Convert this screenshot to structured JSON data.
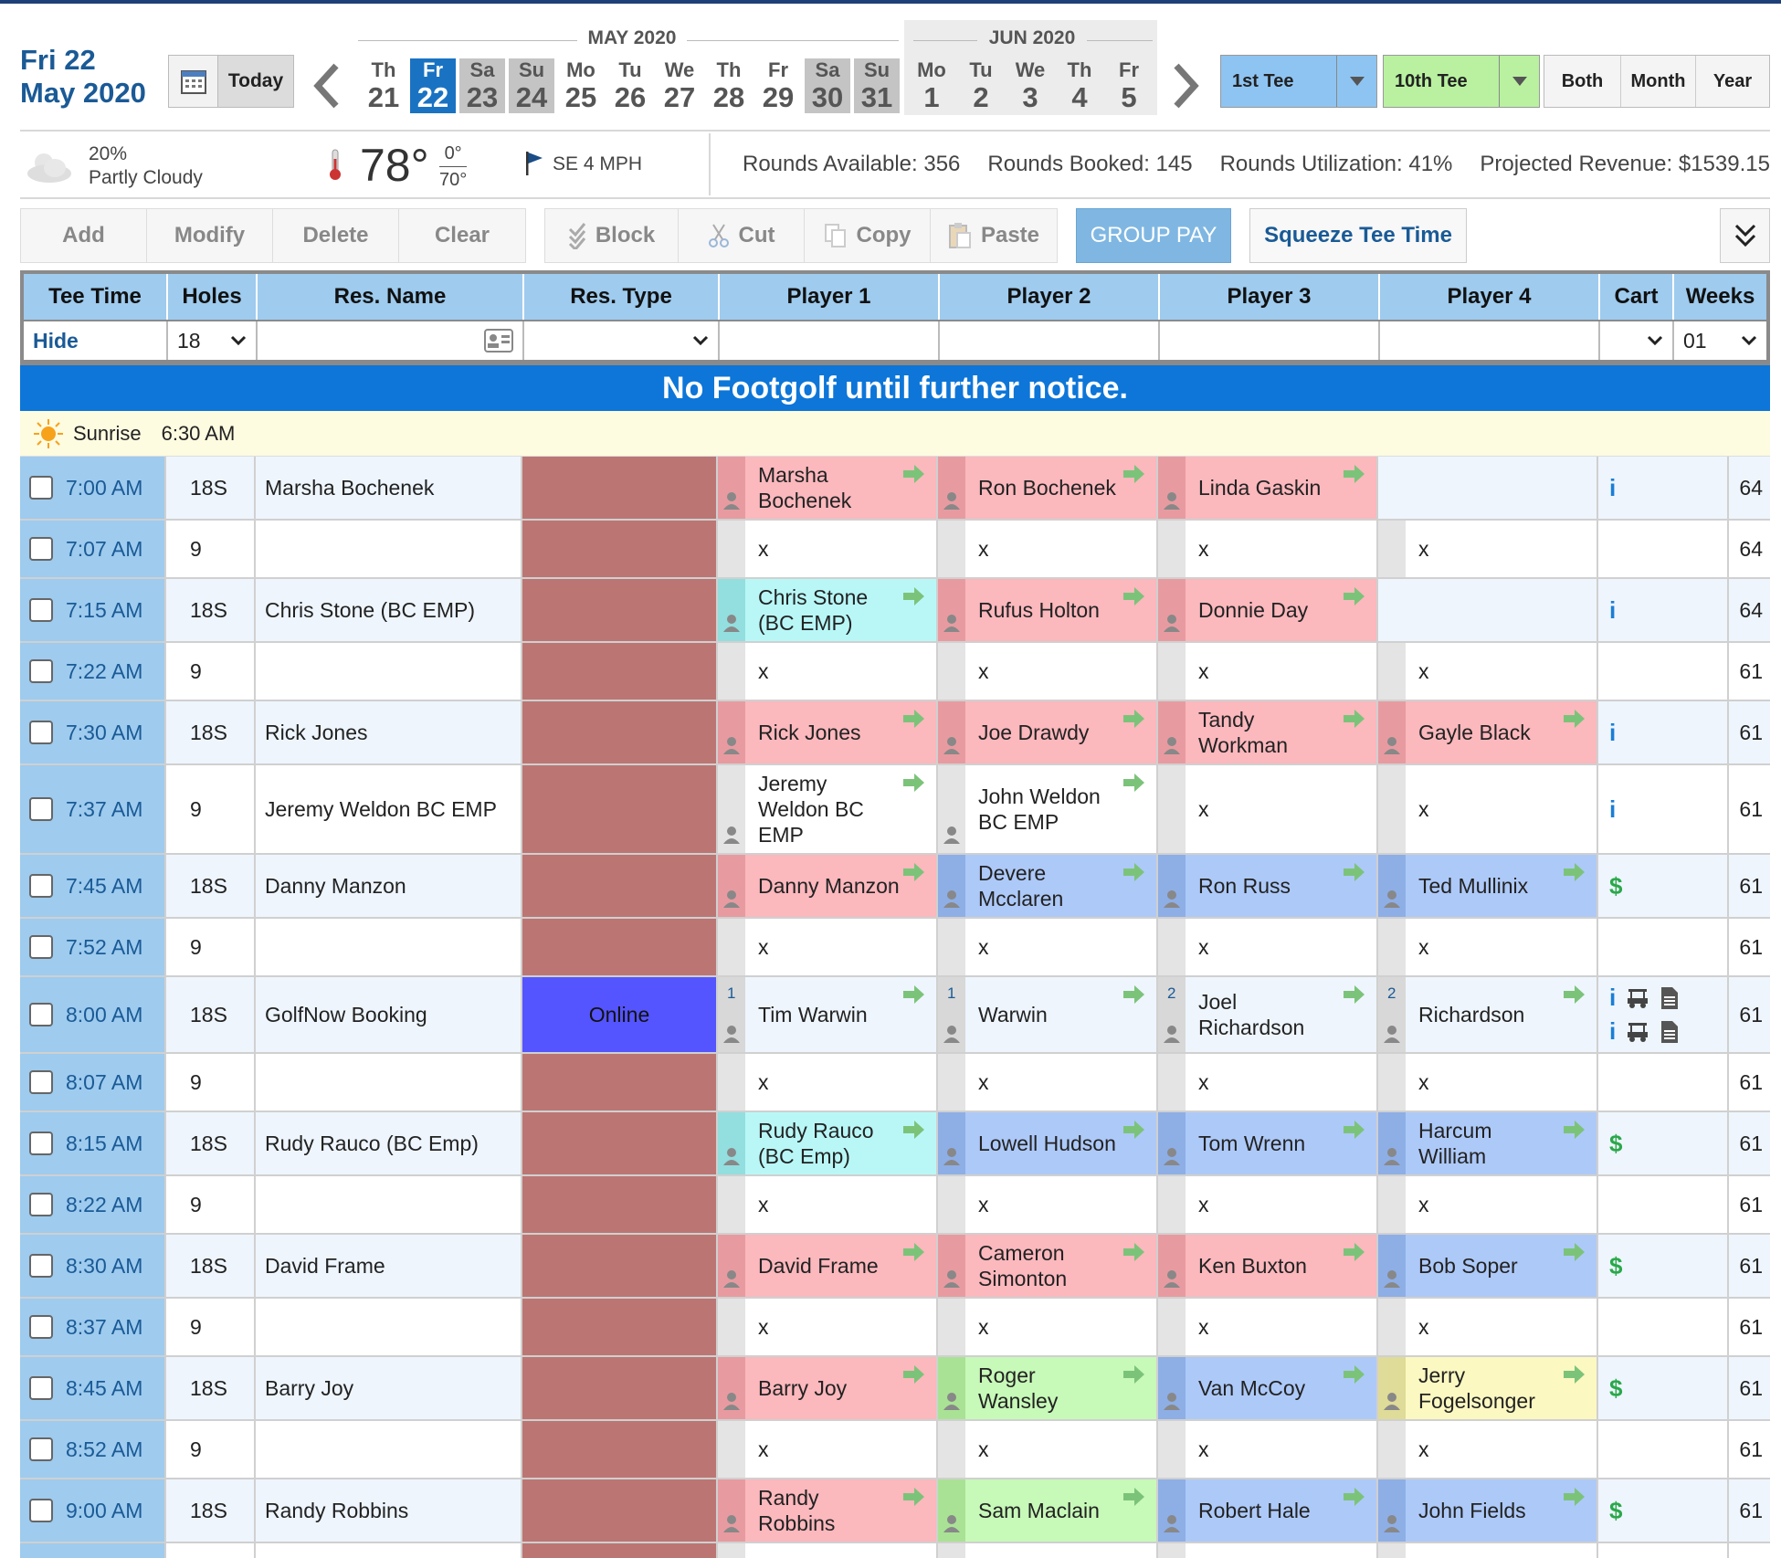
{
  "header": {
    "date_line1": "Fri 22",
    "date_line2": "May 2020",
    "today_label": "Today",
    "month1": "MAY 2020",
    "month2": "JUN 2020",
    "days": [
      {
        "dw": "Th",
        "dn": "21",
        "kind": "normal"
      },
      {
        "dw": "Fr",
        "dn": "22",
        "kind": "selected"
      },
      {
        "dw": "Sa",
        "dn": "23",
        "kind": "weekend"
      },
      {
        "dw": "Su",
        "dn": "24",
        "kind": "weekend"
      },
      {
        "dw": "Mo",
        "dn": "25",
        "kind": "normal"
      },
      {
        "dw": "Tu",
        "dn": "26",
        "kind": "normal"
      },
      {
        "dw": "We",
        "dn": "27",
        "kind": "normal"
      },
      {
        "dw": "Th",
        "dn": "28",
        "kind": "normal"
      },
      {
        "dw": "Fr",
        "dn": "29",
        "kind": "normal"
      },
      {
        "dw": "Sa",
        "dn": "30",
        "kind": "weekend"
      },
      {
        "dw": "Su",
        "dn": "31",
        "kind": "weekend"
      },
      {
        "dw": "Mo",
        "dn": "1",
        "kind": "normal"
      },
      {
        "dw": "Tu",
        "dn": "2",
        "kind": "normal"
      },
      {
        "dw": "We",
        "dn": "3",
        "kind": "normal"
      },
      {
        "dw": "Th",
        "dn": "4",
        "kind": "normal"
      },
      {
        "dw": "Fr",
        "dn": "5",
        "kind": "normal"
      }
    ],
    "tee1_label": "1st Tee",
    "tee10_label": "10th Tee",
    "view_buttons": [
      "Both",
      "Month",
      "Year"
    ]
  },
  "weather": {
    "precip": "20%",
    "condition": "Partly Cloudy",
    "temp": "78°",
    "temp_high": "0°",
    "temp_low": "70°",
    "wind": "SE 4 MPH"
  },
  "stats": {
    "rounds_available": "Rounds Available: 356",
    "rounds_booked": "Rounds Booked: 145",
    "utilization": "Rounds Utilization: 41%",
    "revenue": "Projected Revenue: $1539.15"
  },
  "toolbar": {
    "add": "Add",
    "modify": "Modify",
    "delete": "Delete",
    "clear": "Clear",
    "block": "Block",
    "cut": "Cut",
    "copy": "Copy",
    "paste": "Paste",
    "group_pay": "GROUP PAY",
    "squeeze": "Squeeze Tee Time"
  },
  "columns": [
    "Tee Time",
    "Holes",
    "Res. Name",
    "Res. Type",
    "Player 1",
    "Player 2",
    "Player 3",
    "Player 4",
    "Cart",
    "Weeks"
  ],
  "filters": {
    "hide": "Hide",
    "holes": "18",
    "weeks": "01"
  },
  "notice": "No Footgolf until further notice.",
  "sunrise": {
    "label": "Sunrise",
    "time": "6:30 AM"
  },
  "colors": {
    "accent": "#1a5a96",
    "header_blue": "#9ecbee",
    "notice_blue": "#0d76d8",
    "restype_red": "#bb7673",
    "online_blue": "#5555ff"
  },
  "rows": [
    {
      "time": "7:00 AM",
      "holes": "18S",
      "name": "Marsha Bochenek",
      "type": "",
      "players": [
        [
          "Marsha Bochenek",
          "pink"
        ],
        [
          "Ron Bochenek",
          "pink"
        ],
        [
          "Linda Gaskin",
          "pink"
        ],
        [
          "",
          "none"
        ]
      ],
      "cart": "i",
      "weeks": "64",
      "h": 70
    },
    {
      "time": "7:07 AM",
      "holes": "9",
      "name": "",
      "type": "",
      "players": [
        [
          "x",
          "gray"
        ],
        [
          "x",
          "gray"
        ],
        [
          "x",
          "gray"
        ],
        [
          "x",
          "gray"
        ]
      ],
      "cart": "",
      "weeks": "64",
      "h": 64
    },
    {
      "time": "7:15 AM",
      "holes": "18S",
      "name": "Chris Stone (BC EMP)",
      "type": "",
      "players": [
        [
          "Chris Stone (BC EMP)",
          "cyan"
        ],
        [
          "Rufus Holton",
          "pink"
        ],
        [
          "Donnie Day",
          "pink"
        ],
        [
          "",
          "none"
        ]
      ],
      "cart": "i",
      "weeks": "64",
      "h": 70
    },
    {
      "time": "7:22 AM",
      "holes": "9",
      "name": "",
      "type": "",
      "players": [
        [
          "x",
          "gray"
        ],
        [
          "x",
          "gray"
        ],
        [
          "x",
          "gray"
        ],
        [
          "x",
          "gray"
        ]
      ],
      "cart": "",
      "weeks": "61",
      "h": 64
    },
    {
      "time": "7:30 AM",
      "holes": "18S",
      "name": "Rick Jones",
      "type": "",
      "players": [
        [
          "Rick Jones",
          "pink"
        ],
        [
          "Joe Drawdy",
          "pink"
        ],
        [
          "Tandy Workman",
          "pink"
        ],
        [
          "Gayle Black",
          "pink"
        ]
      ],
      "cart": "i",
      "weeks": "61",
      "h": 70
    },
    {
      "time": "7:37 AM",
      "holes": "9",
      "name": "Jeremy Weldon BC EMP",
      "type": "",
      "players": [
        [
          "Jeremy Weldon BC EMP",
          "gray"
        ],
        [
          "John Weldon BC EMP",
          "gray"
        ],
        [
          "x",
          "gray"
        ],
        [
          "x",
          "gray"
        ]
      ],
      "cart": "i",
      "weeks": "61",
      "h": 98
    },
    {
      "time": "7:45 AM",
      "holes": "18S",
      "name": "Danny Manzon",
      "type": "",
      "players": [
        [
          "Danny Manzon",
          "pink"
        ],
        [
          "Devere Mcclaren",
          "blue"
        ],
        [
          "Ron Russ",
          "blue"
        ],
        [
          "Ted Mullinix",
          "blue"
        ]
      ],
      "cart": "$",
      "weeks": "61",
      "h": 70
    },
    {
      "time": "7:52 AM",
      "holes": "9",
      "name": "",
      "type": "",
      "players": [
        [
          "x",
          "gray"
        ],
        [
          "x",
          "gray"
        ],
        [
          "x",
          "gray"
        ],
        [
          "x",
          "gray"
        ]
      ],
      "cart": "",
      "weeks": "61",
      "h": 64
    },
    {
      "time": "8:00 AM",
      "holes": "18S",
      "name": "GolfNow Booking",
      "type": "Online",
      "players": [
        [
          "Tim Warwin",
          "gray",
          "1"
        ],
        [
          "Warwin",
          "gray",
          "1"
        ],
        [
          "Joel Richardson",
          "gray",
          "2"
        ],
        [
          "Richardson",
          "gray",
          "2"
        ]
      ],
      "cart": "multi",
      "weeks": "61",
      "h": 84
    },
    {
      "time": "8:07 AM",
      "holes": "9",
      "name": "",
      "type": "",
      "players": [
        [
          "x",
          "gray"
        ],
        [
          "x",
          "gray"
        ],
        [
          "x",
          "gray"
        ],
        [
          "x",
          "gray"
        ]
      ],
      "cart": "",
      "weeks": "61",
      "h": 64
    },
    {
      "time": "8:15 AM",
      "holes": "18S",
      "name": "Rudy Rauco (BC Emp)",
      "type": "",
      "players": [
        [
          "Rudy Rauco (BC Emp)",
          "cyan"
        ],
        [
          "Lowell Hudson",
          "blue"
        ],
        [
          "Tom Wrenn",
          "blue"
        ],
        [
          "Harcum William",
          "blue"
        ]
      ],
      "cart": "$",
      "weeks": "61",
      "h": 70
    },
    {
      "time": "8:22 AM",
      "holes": "9",
      "name": "",
      "type": "",
      "players": [
        [
          "x",
          "gray"
        ],
        [
          "x",
          "gray"
        ],
        [
          "x",
          "gray"
        ],
        [
          "x",
          "gray"
        ]
      ],
      "cart": "",
      "weeks": "61",
      "h": 64
    },
    {
      "time": "8:30 AM",
      "holes": "18S",
      "name": "David Frame",
      "type": "",
      "players": [
        [
          "David Frame",
          "pink"
        ],
        [
          "Cameron Simonton",
          "pink"
        ],
        [
          "Ken Buxton",
          "pink"
        ],
        [
          "Bob Soper",
          "blue"
        ]
      ],
      "cart": "$",
      "weeks": "61",
      "h": 70
    },
    {
      "time": "8:37 AM",
      "holes": "9",
      "name": "",
      "type": "",
      "players": [
        [
          "x",
          "gray"
        ],
        [
          "x",
          "gray"
        ],
        [
          "x",
          "gray"
        ],
        [
          "x",
          "gray"
        ]
      ],
      "cart": "",
      "weeks": "61",
      "h": 64
    },
    {
      "time": "8:45 AM",
      "holes": "18S",
      "name": "Barry Joy",
      "type": "",
      "players": [
        [
          "Barry Joy",
          "pink"
        ],
        [
          "Roger Wansley",
          "green"
        ],
        [
          "Van McCoy",
          "blue"
        ],
        [
          "Jerry Fogelsonger",
          "yellow"
        ]
      ],
      "cart": "$",
      "weeks": "61",
      "h": 70
    },
    {
      "time": "8:52 AM",
      "holes": "9",
      "name": "",
      "type": "",
      "players": [
        [
          "x",
          "gray"
        ],
        [
          "x",
          "gray"
        ],
        [
          "x",
          "gray"
        ],
        [
          "x",
          "gray"
        ]
      ],
      "cart": "",
      "weeks": "61",
      "h": 64
    },
    {
      "time": "9:00 AM",
      "holes": "18S",
      "name": "Randy Robbins",
      "type": "",
      "players": [
        [
          "Randy Robbins",
          "pink"
        ],
        [
          "Sam Maclain",
          "green"
        ],
        [
          "Robert Hale",
          "blue"
        ],
        [
          "John Fields",
          "blue"
        ]
      ],
      "cart": "$",
      "weeks": "61",
      "h": 70
    },
    {
      "time": "",
      "holes": "",
      "name": "",
      "type": "",
      "players": [
        [
          "",
          "gray"
        ],
        [
          "",
          "gray"
        ],
        [
          "",
          "gray"
        ],
        [
          "",
          "gray"
        ]
      ],
      "cart": "",
      "weeks": "",
      "h": 40
    }
  ]
}
